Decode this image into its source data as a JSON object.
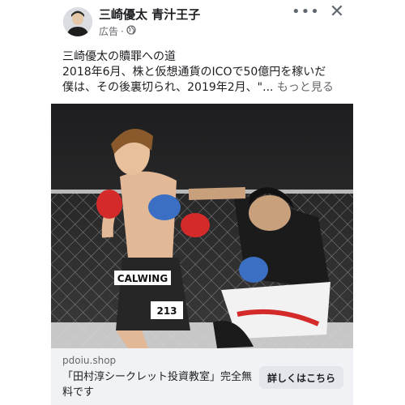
{
  "post": {
    "page_name": "三崎優太 青汁王子",
    "sponsored_label": "広告",
    "meta_separator": "·",
    "more_icon": "more-horizontal-icon",
    "close_icon": "close-icon",
    "globe_icon": "globe-icon",
    "text_lines": [
      "三崎優太の贖罪への道",
      "2018年6月、株と仮想通貨のICOで50億円を稼いだ",
      "僕は、その後裏切られ、2019年2月、\"..."
    ],
    "see_more": "もっと見る"
  },
  "image": {
    "shorts_brand": "CALWING",
    "shorts_number": "213"
  },
  "link_preview": {
    "domain": "pdoiu.shop",
    "headline": "「田村淳シークレット投資教室」完全無料です",
    "cta_label": "詳しくはこちら"
  },
  "colors": {
    "text": "#1c1e21",
    "secondary_text": "#65676b",
    "footer_bg": "#f0f2f5",
    "button_bg": "#e4e6eb",
    "glove_red": "#d42a2a",
    "glove_blue": "#3a6fc4"
  }
}
